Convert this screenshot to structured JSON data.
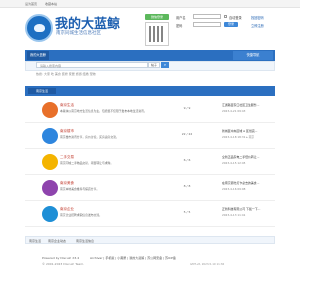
{
  "topbar": {
    "left": [
      "设为首页",
      "收藏本站"
    ],
    "right": []
  },
  "logo": {
    "title": "我的大蓝鲸",
    "subtitle": "南京同城生活信息社区"
  },
  "login": {
    "wechat_label": "微信登录",
    "username_label": "用户名",
    "password_label": "密码",
    "auto_login": "自动登录",
    "forgot": "找回密码",
    "login_btn": "登录",
    "register": "立即注册"
  },
  "nav": {
    "home": "我的大蓝鲸",
    "right": "快捷导航"
  },
  "search": {
    "placeholder": "请输入搜索内容",
    "type": "帖子",
    "button": "⌕",
    "hot": "热搜: 大家  吃  美食  装修  家居  旅游  结婚  宠物"
  },
  "crumb": {
    "path": "🏠 › 蓝鲸论坛"
  },
  "section": {
    "title": "南京生活"
  },
  "forums": [
    {
      "title": "南京生活",
      "desc": "本版块以南京地方生活信息为主，包括但不仅限于发布本地生活资讯。",
      "stats": "9 / 9",
      "last1": "汇通路百家口社区卫生服务...",
      "last2": "2023-4-21 09:43"
    },
    {
      "title": "南京楼市",
      "desc": "南京楼市资讯分享，房价讨论，买房卖房交流。",
      "stats": "22 / 22",
      "last1": "新城区中央区域 A 区划完...",
      "last2": "2023-4-18 18:31 ▸ 南京"
    },
    {
      "title": "二手交易",
      "desc": "南京同城二手物品交易，闲置转让与求购。",
      "stats": "6 / 6",
      "last1": "全新正品家电二手低价转让...",
      "last2": "2023-4-15 12:45"
    },
    {
      "title": "南京美食",
      "desc": "南京本地美食推荐与探店分享。",
      "stats": "8 / 8",
      "last1": "在南京逛吃打卡必去的美食...",
      "last2": "2023-4-16 09:08"
    },
    {
      "title": "南京企业",
      "desc": "南京企业招聘求职信息发布交流。",
      "stats": "5 / 5",
      "last1": "正新科技有限公司 下载一下...",
      "last2": "2023-4-13 11:41"
    }
  ],
  "bottom_bar": {
    "items": [
      "南京生活",
      "南京企业动态",
      "南京生活信息"
    ]
  },
  "footer": {
    "powered": "Powered by Discuz! X3.4",
    "copyright": "© 2001-2023 Discuz! Team.",
    "links": "Archiver | 手机版 | 小黑屋 | 我的大蓝鲸 | 苏公网安备 | 苏ICP备",
    "time": "GMT+8, 2023-5-19 11:36"
  }
}
